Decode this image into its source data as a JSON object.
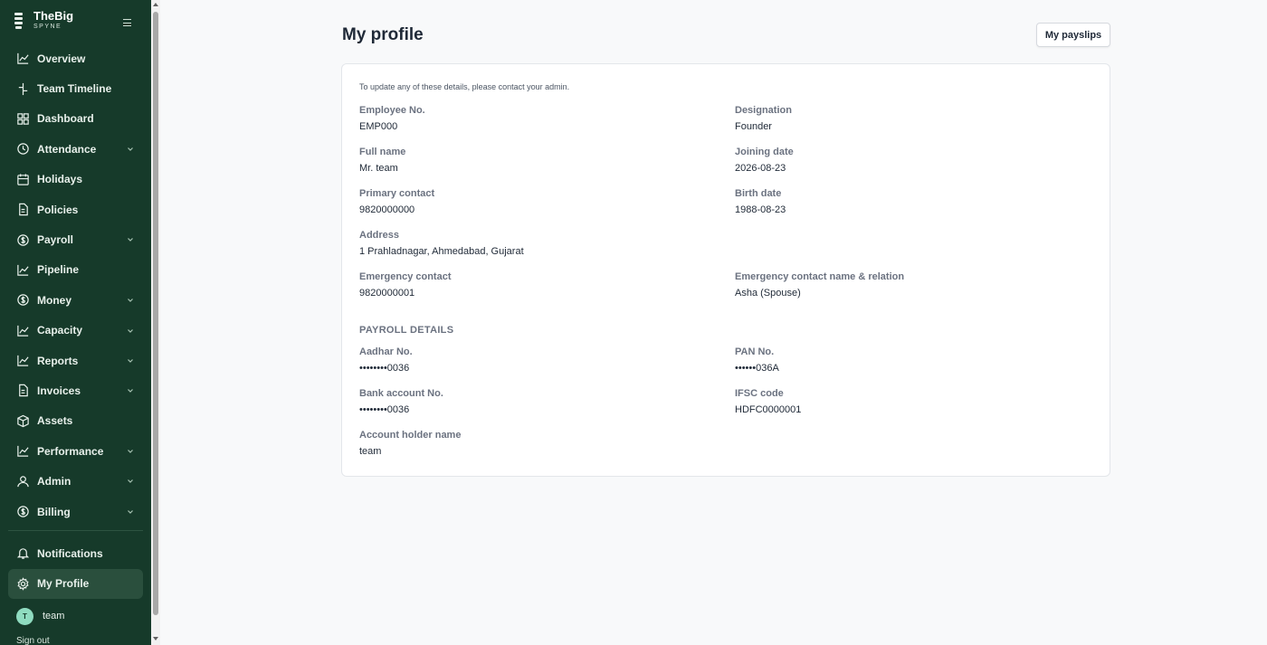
{
  "brand": {
    "name": "TheBig",
    "sub": "SPYNE"
  },
  "sidebar": {
    "items": [
      {
        "label": "Overview",
        "icon": "chart-line-icon",
        "chevron": false
      },
      {
        "label": "Team Timeline",
        "icon": "timeline-icon",
        "chevron": false
      },
      {
        "label": "Dashboard",
        "icon": "grid-icon",
        "chevron": false
      },
      {
        "label": "Attendance",
        "icon": "clock-icon",
        "chevron": true
      },
      {
        "label": "Holidays",
        "icon": "calendar-icon",
        "chevron": false
      },
      {
        "label": "Policies",
        "icon": "document-icon",
        "chevron": false
      },
      {
        "label": "Payroll",
        "icon": "dollar-circle-icon",
        "chevron": true
      },
      {
        "label": "Pipeline",
        "icon": "chart-line-icon",
        "chevron": false
      },
      {
        "label": "Money",
        "icon": "dollar-circle-icon",
        "chevron": true
      },
      {
        "label": "Capacity",
        "icon": "chart-line-icon",
        "chevron": true
      },
      {
        "label": "Reports",
        "icon": "chart-line-icon",
        "chevron": true
      },
      {
        "label": "Invoices",
        "icon": "document-icon",
        "chevron": true
      },
      {
        "label": "Assets",
        "icon": "box-icon",
        "chevron": false
      },
      {
        "label": "Performance",
        "icon": "chart-line-icon",
        "chevron": true
      },
      {
        "label": "Admin",
        "icon": "user-icon",
        "chevron": true
      },
      {
        "label": "Billing",
        "icon": "dollar-circle-icon",
        "chevron": true
      }
    ],
    "bottom": [
      {
        "label": "Notifications",
        "icon": "bell-icon"
      },
      {
        "label": "My Profile",
        "icon": "gear-icon",
        "active": true
      }
    ],
    "user": {
      "initial": "T",
      "name": "team"
    },
    "signout": "Sign out"
  },
  "main": {
    "title": "My profile",
    "payslips_button": "My payslips",
    "note": "To update any of these details, please contact your admin.",
    "fields": [
      {
        "label": "Employee No.",
        "value": "EMP000"
      },
      {
        "label": "Designation",
        "value": "Founder"
      },
      {
        "label": "Full name",
        "value": "Mr. team"
      },
      {
        "label": "Joining date",
        "value": "2026-08-23"
      },
      {
        "label": "Primary contact",
        "value": "9820000000"
      },
      {
        "label": "Birth date",
        "value": "1988-08-23"
      },
      {
        "label": "Address",
        "value": "1 Prahladnagar, Ahmedabad, Gujarat"
      },
      {
        "label": "Emergency contact",
        "value": "9820000001"
      },
      {
        "label": "Emergency contact name & relation",
        "value": "Asha (Spouse)"
      }
    ],
    "payroll_title": "PAYROLL DETAILS",
    "payroll_fields": [
      {
        "label": "Aadhar No.",
        "value": "••••••••0036"
      },
      {
        "label": "PAN No.",
        "value": "••••••036A"
      },
      {
        "label": "Bank account No.",
        "value": "••••••••0036"
      },
      {
        "label": "IFSC code",
        "value": "HDFC0000001"
      },
      {
        "label": "Account holder name",
        "value": "team"
      }
    ]
  },
  "colors": {
    "sidebar_bg": "#163a2a",
    "active_bg": "#2a4f3d",
    "avatar_bg": "#8fdcc0",
    "page_bg": "#f8f9fa"
  }
}
